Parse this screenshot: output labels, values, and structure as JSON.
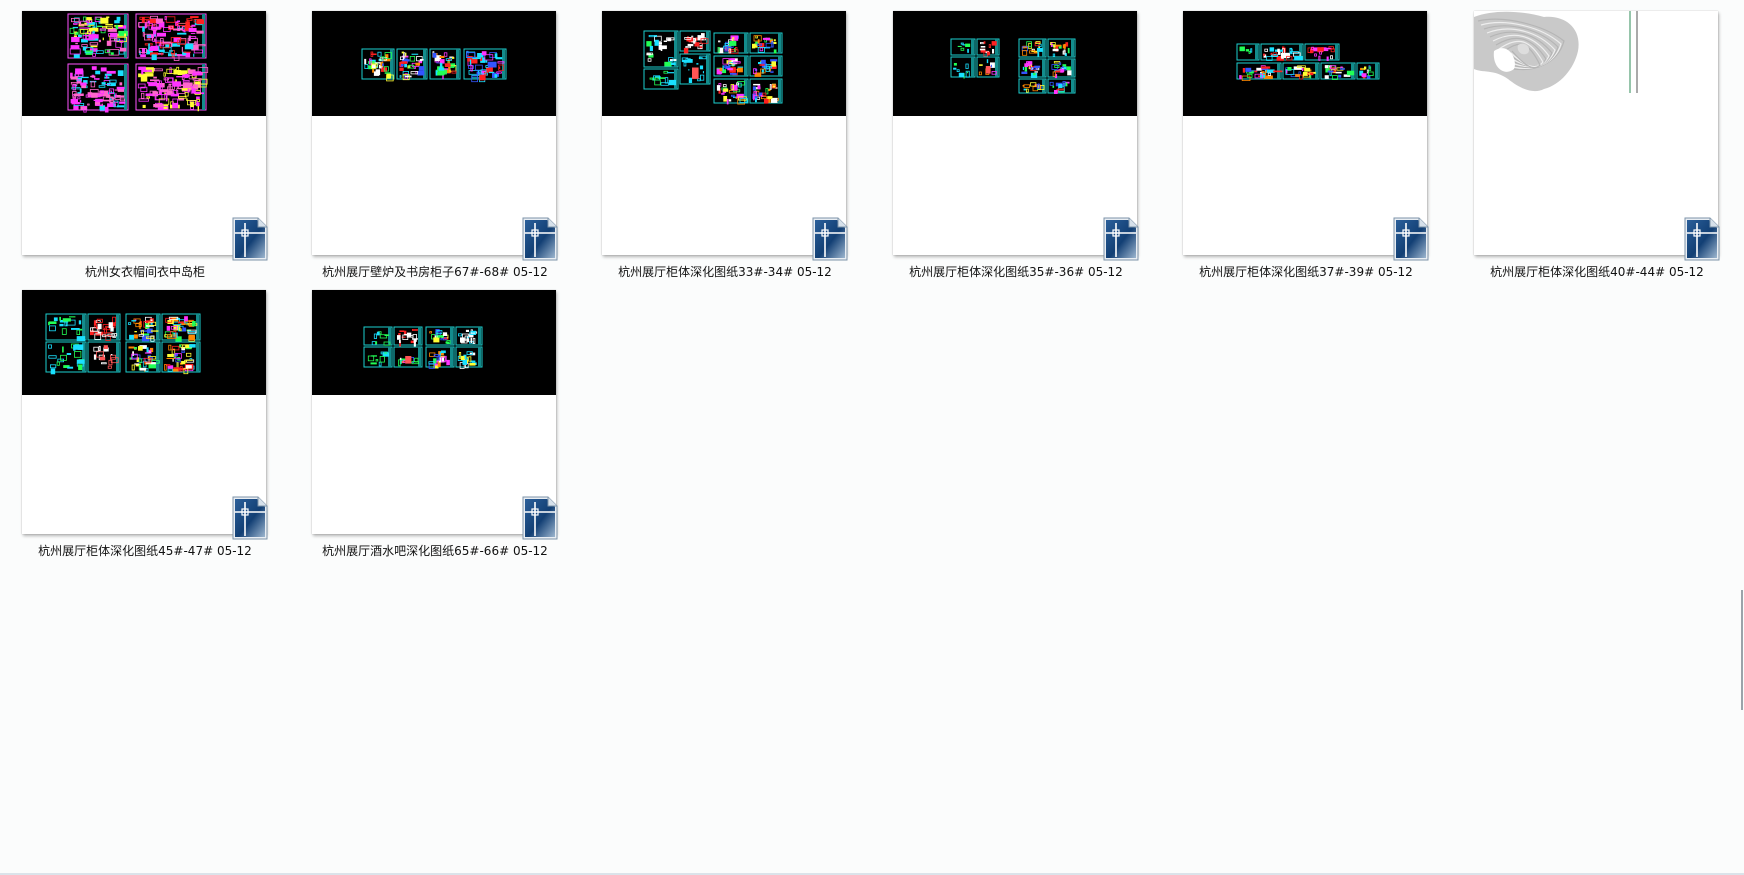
{
  "files": [
    {
      "name": "杭州女衣帽间衣中岛柜",
      "preview": "magenta-sheets"
    },
    {
      "name": "杭州展厅壁炉及书房柜子67#-68# 05-12",
      "preview": "wide-strip"
    },
    {
      "name": "杭州展厅柜体深化图纸33#-34# 05-12",
      "preview": "two-groups-tall"
    },
    {
      "name": "杭州展厅柜体深化图纸35#-36# 05-12",
      "preview": "two-groups-small"
    },
    {
      "name": "杭州展厅柜体深化图纸37#-39# 05-12",
      "preview": "thin-strip"
    },
    {
      "name": "杭州展厅柜体深化图纸40#-44# 05-12",
      "preview": "white-sketch"
    },
    {
      "name": "杭州展厅柜体深化图纸45#-47# 05-12",
      "preview": "dense-sheets"
    },
    {
      "name": "杭州展厅酒水吧深化图纸65#-66# 05-12",
      "preview": "medium-sheets"
    }
  ],
  "icons": {
    "file_type": "cad-drawing-file-icon"
  },
  "colors": {
    "background": "#fbfcfc",
    "preview_black": "#000000",
    "icon_blue": "#1f4f86"
  }
}
